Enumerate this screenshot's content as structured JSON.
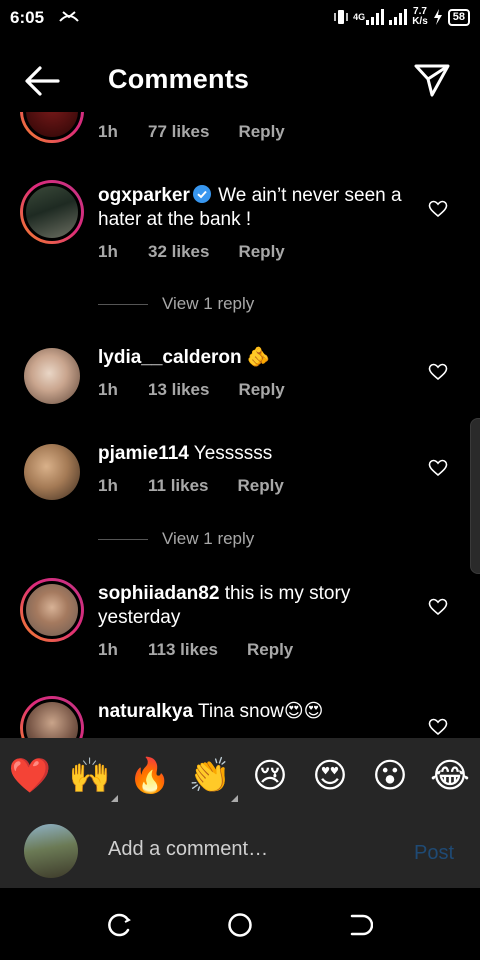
{
  "status": {
    "time": "6:05",
    "net_badge": "4G",
    "speed_value": "7.7",
    "speed_unit": "K/s",
    "battery": "58"
  },
  "header": {
    "title": "Comments"
  },
  "comments": [
    {
      "user": "",
      "text": "",
      "time": "1h",
      "likes": "77 likes",
      "reply": "Reply"
    },
    {
      "user": "ogxparker",
      "text": "We ain’t never seen a hater at the bank !",
      "time": "1h",
      "likes": "32 likes",
      "reply": "Reply",
      "verified": true
    },
    {
      "user": "lydia__calderon",
      "text": "🫵",
      "time": "1h",
      "likes": "13 likes",
      "reply": "Reply"
    },
    {
      "user": "pjamie114",
      "text": "Yessssss",
      "time": "1h",
      "likes": "11 likes",
      "reply": "Reply"
    },
    {
      "user": "sophiiadan82",
      "text": "this is my story yesterday",
      "time": "1h",
      "likes": "113 likes",
      "reply": "Reply"
    },
    {
      "user": "naturalkya",
      "text": "Tina snow😍😍"
    }
  ],
  "view_replies": [
    "View 1 reply",
    "View 1 reply"
  ],
  "emoji_bar": [
    {
      "glyph": "❤️",
      "icon": "red-heart-emoji"
    },
    {
      "glyph": "🙌",
      "icon": "raising-hands-emoji"
    },
    {
      "glyph": "🔥",
      "icon": "fire-emoji"
    },
    {
      "glyph": "👏",
      "icon": "clapping-hands-emoji"
    },
    {
      "glyph": "😢",
      "icon": "crying-face-emoji"
    },
    {
      "glyph": "😍",
      "icon": "heart-eyes-emoji"
    },
    {
      "glyph": "😮",
      "icon": "surprised-face-emoji"
    },
    {
      "glyph": "😂",
      "icon": "tears-of-joy-emoji"
    }
  ],
  "composer": {
    "placeholder": "Add a comment…",
    "post_label": "Post"
  },
  "colors": {
    "verified": "#3897f0",
    "meta_text": "#a8a8a8",
    "post_disabled": "#1f4a74",
    "panel": "#262626"
  }
}
